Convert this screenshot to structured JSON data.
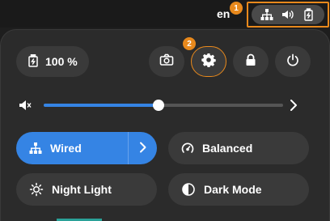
{
  "topbar": {
    "language": "en",
    "tray_icons": [
      "network-wired-icon",
      "volume-icon",
      "battery-charging-icon"
    ]
  },
  "badges": {
    "one": "1",
    "two": "2"
  },
  "battery": {
    "label": "100 %"
  },
  "actions": [
    "screenshot-icon",
    "settings-icon",
    "lock-icon",
    "power-icon"
  ],
  "volume": {
    "level": 0.48
  },
  "toggles": {
    "wired": {
      "label": "Wired"
    },
    "balanced": {
      "label": "Balanced"
    },
    "night_light": {
      "label": "Night Light"
    },
    "dark_mode": {
      "label": "Dark Mode"
    }
  },
  "colors": {
    "accent": "#3584e4",
    "highlight": "#e8891c",
    "panel": "#2b2b2b",
    "button": "#3a3a3a"
  }
}
